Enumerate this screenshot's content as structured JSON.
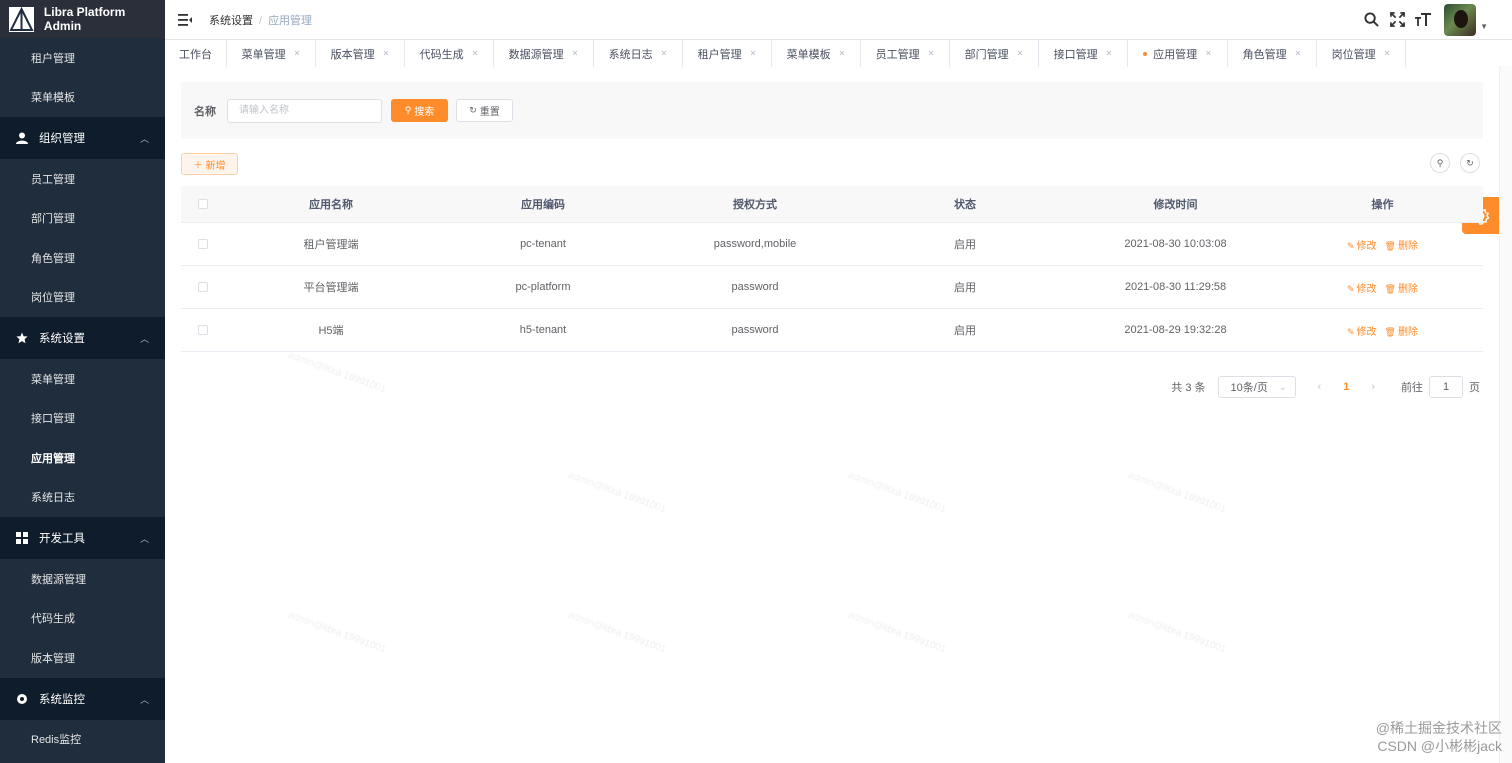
{
  "app": {
    "title": "Libra Platform Admin"
  },
  "colors": {
    "accent": "#ff8c2a",
    "sidebar_bg": "#1f2d3d",
    "sidebar_group_bg": "#0f1c2b"
  },
  "sidebar": {
    "top_items": [
      {
        "label": "租户管理"
      },
      {
        "label": "菜单模板"
      }
    ],
    "groups": [
      {
        "label": "组织管理",
        "icon": "user-icon",
        "items": [
          {
            "label": "员工管理"
          },
          {
            "label": "部门管理"
          },
          {
            "label": "角色管理"
          },
          {
            "label": "岗位管理"
          }
        ]
      },
      {
        "label": "系统设置",
        "icon": "star-icon",
        "items": [
          {
            "label": "菜单管理"
          },
          {
            "label": "接口管理"
          },
          {
            "label": "应用管理",
            "active": true
          },
          {
            "label": "系统日志"
          }
        ]
      },
      {
        "label": "开发工具",
        "icon": "grid-icon",
        "items": [
          {
            "label": "数据源管理"
          },
          {
            "label": "代码生成"
          },
          {
            "label": "版本管理"
          }
        ]
      },
      {
        "label": "系统监控",
        "icon": "monitor-icon",
        "items": [
          {
            "label": "Redis监控"
          }
        ]
      }
    ]
  },
  "header": {
    "breadcrumb": [
      "系统设置",
      "应用管理"
    ],
    "separator": "/"
  },
  "tags": [
    {
      "label": "工作台",
      "closable": false
    },
    {
      "label": "菜单管理",
      "closable": true
    },
    {
      "label": "版本管理",
      "closable": true
    },
    {
      "label": "代码生成",
      "closable": true
    },
    {
      "label": "数据源管理",
      "closable": true
    },
    {
      "label": "系统日志",
      "closable": true
    },
    {
      "label": "租户管理",
      "closable": true
    },
    {
      "label": "菜单模板",
      "closable": true
    },
    {
      "label": "员工管理",
      "closable": true
    },
    {
      "label": "部门管理",
      "closable": true
    },
    {
      "label": "接口管理",
      "closable": true
    },
    {
      "label": "应用管理",
      "closable": true,
      "active": true
    },
    {
      "label": "角色管理",
      "closable": true
    },
    {
      "label": "岗位管理",
      "closable": true
    }
  ],
  "search": {
    "label": "名称",
    "placeholder": "请输入名称",
    "search_button": "搜索",
    "reset_button": "重置"
  },
  "toolbar": {
    "add_button": "新增"
  },
  "table": {
    "columns": [
      "应用名称",
      "应用编码",
      "授权方式",
      "状态",
      "修改时间",
      "操作"
    ],
    "rows": [
      {
        "name": "租户管理端",
        "code": "pc-tenant",
        "auth": "password,mobile",
        "status": "启用",
        "time": "2021-08-30 10:03:08"
      },
      {
        "name": "平台管理端",
        "code": "pc-platform",
        "auth": "password",
        "status": "启用",
        "time": "2021-08-30 11:29:58"
      },
      {
        "name": "H5端",
        "code": "h5-tenant",
        "auth": "password",
        "status": "启用",
        "time": "2021-08-29 19:32:28"
      }
    ],
    "edit_label": "修改",
    "delete_label": "删除"
  },
  "pagination": {
    "total_text": "共 3 条",
    "page_size": "10条/页",
    "current_page": "1",
    "goto_prefix": "前往",
    "goto_value": "1",
    "goto_suffix": "页"
  },
  "watermark": {
    "line1": "@稀土掘金技术社区",
    "line2": "CSDN @小彬彬jack"
  }
}
